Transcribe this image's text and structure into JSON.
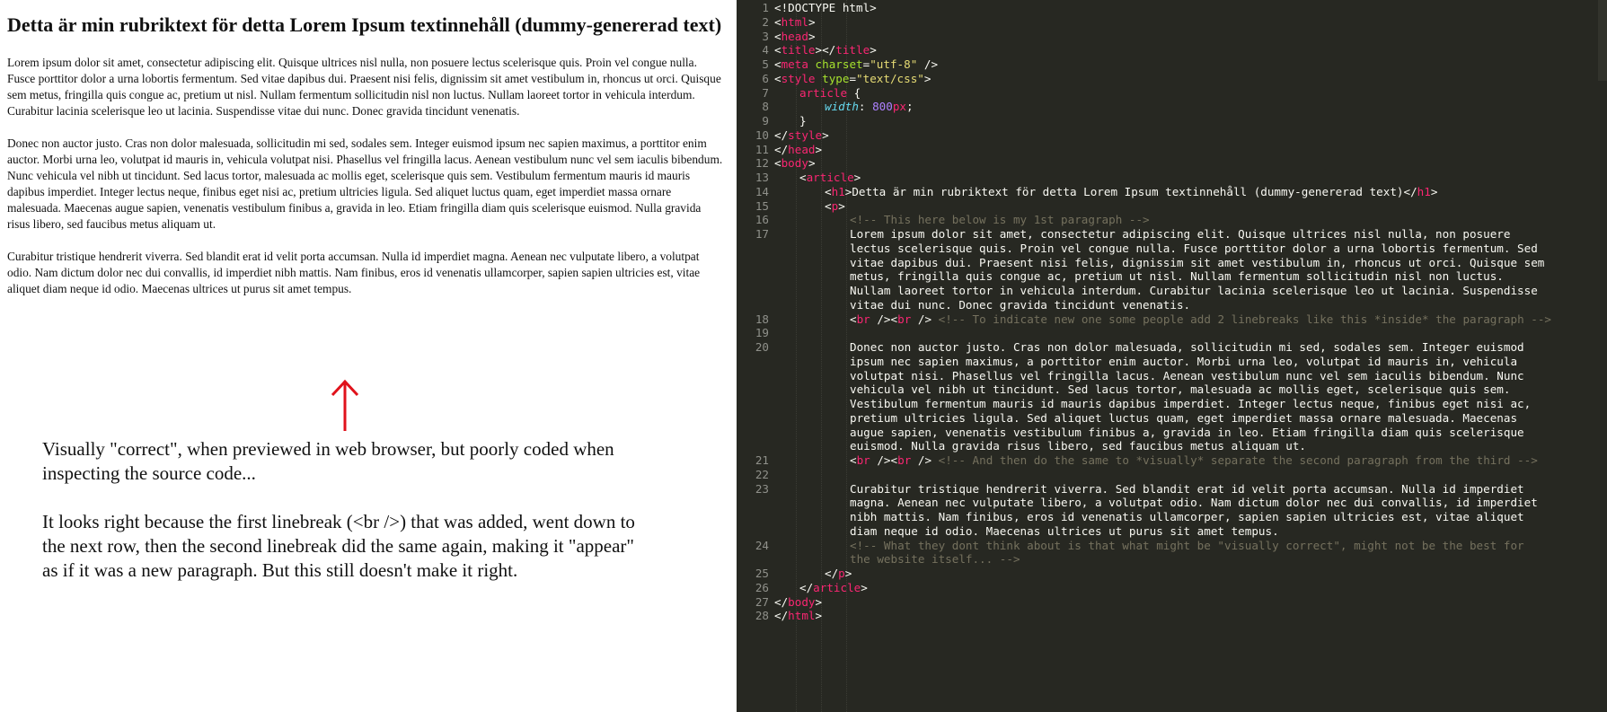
{
  "preview": {
    "heading": "Detta är min rubriktext för detta Lorem Ipsum textinnehåll (dummy-genererad text)",
    "paragraphs": [
      "Lorem ipsum dolor sit amet, consectetur adipiscing elit. Quisque ultrices nisl nulla, non posuere lectus scelerisque quis. Proin vel congue nulla. Fusce porttitor dolor a urna lobortis fermentum. Sed vitae dapibus dui. Praesent nisi felis, dignissim sit amet vestibulum in, rhoncus ut orci. Quisque sem metus, fringilla quis congue ac, pretium ut nisl. Nullam fermentum sollicitudin nisl non luctus. Nullam laoreet tortor in vehicula interdum. Curabitur lacinia scelerisque leo ut lacinia. Suspendisse vitae dui nunc. Donec gravida tincidunt venenatis.",
      "Donec non auctor justo. Cras non dolor malesuada, sollicitudin mi sed, sodales sem. Integer euismod ipsum nec sapien maximus, a porttitor enim auctor. Morbi urna leo, volutpat id mauris in, vehicula volutpat nisi. Phasellus vel fringilla lacus. Aenean vestibulum nunc vel sem iaculis bibendum. Nunc vehicula vel nibh ut tincidunt. Sed lacus tortor, malesuada ac mollis eget, scelerisque quis sem. Vestibulum fermentum mauris id mauris dapibus imperdiet. Integer lectus neque, finibus eget nisi ac, pretium ultricies ligula. Sed aliquet luctus quam, eget imperdiet massa ornare malesuada. Maecenas augue sapien, venenatis vestibulum finibus a, gravida in leo. Etiam fringilla diam quis scelerisque euismod. Nulla gravida risus libero, sed faucibus metus aliquam ut.",
      "Curabitur tristique hendrerit viverra. Sed blandit erat id velit porta accumsan. Nulla id imperdiet magna. Aenean nec vulputate libero, a volutpat odio. Nam dictum dolor nec dui convallis, id imperdiet nibh mattis. Nam finibus, eros id venenatis ullamcorper, sapien sapien ultricies est, vitae aliquet diam neque id odio. Maecenas ultrices ut purus sit amet tempus."
    ]
  },
  "annotation": {
    "arrow_color": "#e0121b",
    "note_1": "Visually \"correct\", when previewed in web browser, but poorly coded when inspecting the source code...",
    "note_2": "It looks right because the first linebreak (<br />) that was added, went down to the next row, then the second linebreak did the same again, making it \"appear\" as if it was a new paragraph. But this still doesn't make it right."
  },
  "editor": {
    "theme_colors": {
      "background": "#272822",
      "tag": "#f92672",
      "attr": "#a6e22e",
      "string": "#e6db74",
      "comment": "#75715e",
      "property": "#66d9ef",
      "number": "#ae81ff"
    },
    "lines": [
      {
        "n": "1",
        "indent": 0,
        "parts": [
          [
            "txt",
            "<!DOCTYPE html>"
          ]
        ]
      },
      {
        "n": "2",
        "indent": 0,
        "parts": [
          [
            "txt",
            "<"
          ],
          [
            "tag",
            "html"
          ],
          [
            "txt",
            ">"
          ]
        ]
      },
      {
        "n": "3",
        "indent": 0,
        "parts": [
          [
            "txt",
            "<"
          ],
          [
            "tag",
            "head"
          ],
          [
            "txt",
            ">"
          ]
        ]
      },
      {
        "n": "4",
        "indent": 0,
        "parts": [
          [
            "txt",
            "<"
          ],
          [
            "tag",
            "title"
          ],
          [
            "txt",
            "></"
          ],
          [
            "tag",
            "title"
          ],
          [
            "txt",
            ">"
          ]
        ]
      },
      {
        "n": "5",
        "indent": 0,
        "parts": [
          [
            "txt",
            "<"
          ],
          [
            "tag",
            "meta"
          ],
          [
            "txt",
            " "
          ],
          [
            "attr",
            "charset"
          ],
          [
            "txt",
            "="
          ],
          [
            "str",
            "\"utf-8\""
          ],
          [
            "txt",
            " />"
          ]
        ]
      },
      {
        "n": "6",
        "indent": 0,
        "parts": [
          [
            "txt",
            "<"
          ],
          [
            "tag",
            "style"
          ],
          [
            "txt",
            " "
          ],
          [
            "attr",
            "type"
          ],
          [
            "txt",
            "="
          ],
          [
            "str",
            "\"text/css\""
          ],
          [
            "txt",
            ">"
          ]
        ]
      },
      {
        "n": "7",
        "indent": 1,
        "parts": [
          [
            "tag",
            "article"
          ],
          [
            "txt",
            " {"
          ]
        ]
      },
      {
        "n": "8",
        "indent": 2,
        "parts": [
          [
            "prop",
            "width"
          ],
          [
            "txt",
            ": "
          ],
          [
            "num",
            "800"
          ],
          [
            "tag",
            "px"
          ],
          [
            "txt",
            ";"
          ]
        ]
      },
      {
        "n": "9",
        "indent": 1,
        "parts": [
          [
            "txt",
            "}"
          ]
        ]
      },
      {
        "n": "10",
        "indent": 0,
        "parts": [
          [
            "txt",
            "</"
          ],
          [
            "tag",
            "style"
          ],
          [
            "txt",
            ">"
          ]
        ]
      },
      {
        "n": "11",
        "indent": 0,
        "parts": [
          [
            "txt",
            "</"
          ],
          [
            "tag",
            "head"
          ],
          [
            "txt",
            ">"
          ]
        ]
      },
      {
        "n": "12",
        "indent": 0,
        "parts": [
          [
            "txt",
            "<"
          ],
          [
            "tag",
            "body"
          ],
          [
            "txt",
            ">"
          ]
        ]
      },
      {
        "n": "13",
        "indent": 1,
        "parts": [
          [
            "txt",
            "<"
          ],
          [
            "tag",
            "article"
          ],
          [
            "txt",
            ">"
          ]
        ]
      },
      {
        "n": "14",
        "indent": 2,
        "parts": [
          [
            "txt",
            "<"
          ],
          [
            "tag",
            "h1"
          ],
          [
            "txt",
            ">Detta är min rubriktext för detta Lorem Ipsum textinnehåll (dummy-genererad text)</"
          ],
          [
            "tag",
            "h1"
          ],
          [
            "txt",
            ">"
          ]
        ]
      },
      {
        "n": "15",
        "indent": 2,
        "parts": [
          [
            "txt",
            "<"
          ],
          [
            "tag",
            "p"
          ],
          [
            "txt",
            ">"
          ]
        ]
      },
      {
        "n": "16",
        "indent": 3,
        "parts": [
          [
            "cmt",
            "<!-- This here below is my 1st paragraph -->"
          ]
        ]
      },
      {
        "n": "17",
        "indent": 3,
        "parts": [
          [
            "txt",
            "Lorem ipsum dolor sit amet, consectetur adipiscing elit. Quisque ultrices nisl nulla, non posuere"
          ]
        ]
      },
      {
        "n": "",
        "indent": 3,
        "parts": [
          [
            "txt",
            "lectus scelerisque quis. Proin vel congue nulla. Fusce porttitor dolor a urna lobortis fermentum. Sed"
          ]
        ]
      },
      {
        "n": "",
        "indent": 3,
        "parts": [
          [
            "txt",
            "vitae dapibus dui. Praesent nisi felis, dignissim sit amet vestibulum in, rhoncus ut orci. Quisque sem"
          ]
        ]
      },
      {
        "n": "",
        "indent": 3,
        "parts": [
          [
            "txt",
            "metus, fringilla quis congue ac, pretium ut nisl. Nullam fermentum sollicitudin nisl non luctus."
          ]
        ]
      },
      {
        "n": "",
        "indent": 3,
        "parts": [
          [
            "txt",
            "Nullam laoreet tortor in vehicula interdum. Curabitur lacinia scelerisque leo ut lacinia. Suspendisse"
          ]
        ]
      },
      {
        "n": "",
        "indent": 3,
        "parts": [
          [
            "txt",
            "vitae dui nunc. Donec gravida tincidunt venenatis."
          ]
        ]
      },
      {
        "n": "18",
        "indent": 3,
        "parts": [
          [
            "txt",
            "<"
          ],
          [
            "tag",
            "br"
          ],
          [
            "txt",
            " /><"
          ],
          [
            "tag",
            "br"
          ],
          [
            "txt",
            " /> "
          ],
          [
            "cmt",
            "<!-- To indicate new one some people add 2 linebreaks like this *inside* the paragraph -->"
          ]
        ]
      },
      {
        "n": "19",
        "indent": 0,
        "parts": [
          [
            "txt",
            ""
          ]
        ]
      },
      {
        "n": "20",
        "indent": 3,
        "parts": [
          [
            "txt",
            "Donec non auctor justo. Cras non dolor malesuada, sollicitudin mi sed, sodales sem. Integer euismod"
          ]
        ]
      },
      {
        "n": "",
        "indent": 3,
        "parts": [
          [
            "txt",
            "ipsum nec sapien maximus, a porttitor enim auctor. Morbi urna leo, volutpat id mauris in, vehicula"
          ]
        ]
      },
      {
        "n": "",
        "indent": 3,
        "parts": [
          [
            "txt",
            "volutpat nisi. Phasellus vel fringilla lacus. Aenean vestibulum nunc vel sem iaculis bibendum. Nunc"
          ]
        ]
      },
      {
        "n": "",
        "indent": 3,
        "parts": [
          [
            "txt",
            "vehicula vel nibh ut tincidunt. Sed lacus tortor, malesuada ac mollis eget, scelerisque quis sem."
          ]
        ]
      },
      {
        "n": "",
        "indent": 3,
        "parts": [
          [
            "txt",
            "Vestibulum fermentum mauris id mauris dapibus imperdiet. Integer lectus neque, finibus eget nisi ac,"
          ]
        ]
      },
      {
        "n": "",
        "indent": 3,
        "parts": [
          [
            "txt",
            "pretium ultricies ligula. Sed aliquet luctus quam, eget imperdiet massa ornare malesuada. Maecenas"
          ]
        ]
      },
      {
        "n": "",
        "indent": 3,
        "parts": [
          [
            "txt",
            "augue sapien, venenatis vestibulum finibus a, gravida in leo. Etiam fringilla diam quis scelerisque"
          ]
        ]
      },
      {
        "n": "",
        "indent": 3,
        "parts": [
          [
            "txt",
            "euismod. Nulla gravida risus libero, sed faucibus metus aliquam ut."
          ]
        ]
      },
      {
        "n": "21",
        "indent": 3,
        "parts": [
          [
            "txt",
            "<"
          ],
          [
            "tag",
            "br"
          ],
          [
            "txt",
            " /><"
          ],
          [
            "tag",
            "br"
          ],
          [
            "txt",
            " /> "
          ],
          [
            "cmt",
            "<!-- And then do the same to *visually* separate the second paragraph from the third -->"
          ]
        ]
      },
      {
        "n": "22",
        "indent": 0,
        "parts": [
          [
            "txt",
            ""
          ]
        ]
      },
      {
        "n": "23",
        "indent": 3,
        "parts": [
          [
            "txt",
            "Curabitur tristique hendrerit viverra. Sed blandit erat id velit porta accumsan. Nulla id imperdiet"
          ]
        ]
      },
      {
        "n": "",
        "indent": 3,
        "parts": [
          [
            "txt",
            "magna. Aenean nec vulputate libero, a volutpat odio. Nam dictum dolor nec dui convallis, id imperdiet"
          ]
        ]
      },
      {
        "n": "",
        "indent": 3,
        "parts": [
          [
            "txt",
            "nibh mattis. Nam finibus, eros id venenatis ullamcorper, sapien sapien ultricies est, vitae aliquet"
          ]
        ]
      },
      {
        "n": "",
        "indent": 3,
        "parts": [
          [
            "txt",
            "diam neque id odio. Maecenas ultrices ut purus sit amet tempus."
          ]
        ]
      },
      {
        "n": "24",
        "indent": 3,
        "parts": [
          [
            "cmt",
            "<!-- What they dont think about is that what might be \"visually correct\", might not be the best for"
          ]
        ]
      },
      {
        "n": "",
        "indent": 3,
        "parts": [
          [
            "cmt",
            "the website itself... -->"
          ]
        ]
      },
      {
        "n": "25",
        "indent": 2,
        "parts": [
          [
            "txt",
            "</"
          ],
          [
            "tag",
            "p"
          ],
          [
            "txt",
            ">"
          ]
        ]
      },
      {
        "n": "26",
        "indent": 1,
        "parts": [
          [
            "txt",
            "</"
          ],
          [
            "tag",
            "article"
          ],
          [
            "txt",
            ">"
          ]
        ]
      },
      {
        "n": "27",
        "indent": 0,
        "parts": [
          [
            "txt",
            "</"
          ],
          [
            "tag",
            "body"
          ],
          [
            "txt",
            ">"
          ]
        ]
      },
      {
        "n": "28",
        "indent": 0,
        "parts": [
          [
            "txt",
            "</"
          ],
          [
            "tag",
            "html"
          ],
          [
            "txt",
            ">"
          ]
        ]
      }
    ]
  }
}
